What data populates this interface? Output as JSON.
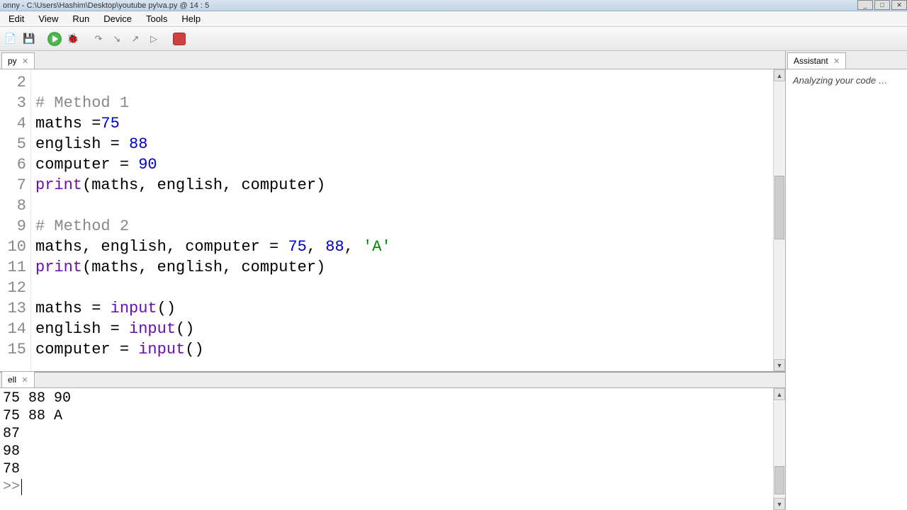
{
  "window": {
    "title": "onny  -  C:\\Users\\Hashim\\Desktop\\youtube py\\va.py  @  14 : 5"
  },
  "menu": {
    "items": [
      "Edit",
      "View",
      "Run",
      "Device",
      "Tools",
      "Help"
    ]
  },
  "editor": {
    "tab_label": "py",
    "lines": [
      {
        "num": "2",
        "segs": [
          {
            "t": "",
            "c": ""
          }
        ]
      },
      {
        "num": "3",
        "segs": [
          {
            "t": "# Method 1",
            "c": "comment"
          }
        ]
      },
      {
        "num": "4",
        "segs": [
          {
            "t": "maths =",
            "c": ""
          },
          {
            "t": "75",
            "c": "num"
          }
        ]
      },
      {
        "num": "5",
        "segs": [
          {
            "t": "english = ",
            "c": ""
          },
          {
            "t": "88",
            "c": "num"
          }
        ]
      },
      {
        "num": "6",
        "segs": [
          {
            "t": "computer = ",
            "c": ""
          },
          {
            "t": "90",
            "c": "num"
          }
        ]
      },
      {
        "num": "7",
        "segs": [
          {
            "t": "print",
            "c": "builtin"
          },
          {
            "t": "(maths, english, computer)",
            "c": ""
          }
        ]
      },
      {
        "num": "8",
        "segs": [
          {
            "t": "",
            "c": ""
          }
        ]
      },
      {
        "num": "9",
        "segs": [
          {
            "t": "# Method 2",
            "c": "comment"
          }
        ]
      },
      {
        "num": "10",
        "segs": [
          {
            "t": "maths, english, computer = ",
            "c": ""
          },
          {
            "t": "75",
            "c": "num"
          },
          {
            "t": ", ",
            "c": ""
          },
          {
            "t": "88",
            "c": "num"
          },
          {
            "t": ", ",
            "c": ""
          },
          {
            "t": "'A'",
            "c": "str"
          }
        ]
      },
      {
        "num": "11",
        "segs": [
          {
            "t": "print",
            "c": "builtin"
          },
          {
            "t": "(maths, english, computer)",
            "c": ""
          }
        ]
      },
      {
        "num": "12",
        "segs": [
          {
            "t": "",
            "c": ""
          }
        ]
      },
      {
        "num": "13",
        "segs": [
          {
            "t": "maths = ",
            "c": ""
          },
          {
            "t": "input",
            "c": "builtin"
          },
          {
            "t": "()",
            "c": ""
          }
        ]
      },
      {
        "num": "14",
        "segs": [
          {
            "t": "english = ",
            "c": ""
          },
          {
            "t": "input",
            "c": "builtin"
          },
          {
            "t": "()",
            "c": ""
          }
        ]
      },
      {
        "num": "15",
        "segs": [
          {
            "t": "computer = ",
            "c": ""
          },
          {
            "t": "input",
            "c": "builtin"
          },
          {
            "t": "()",
            "c": ""
          }
        ]
      }
    ]
  },
  "shell": {
    "tab_label": "ell",
    "lines": [
      "75 88 90",
      "75 88 A",
      "87",
      "98",
      "78"
    ],
    "prompt": ">>"
  },
  "assistant": {
    "title": "Assistant",
    "status": "Analyzing your code …"
  }
}
